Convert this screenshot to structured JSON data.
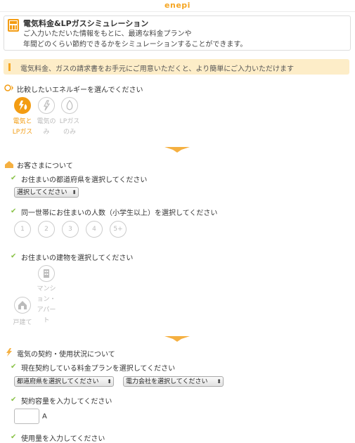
{
  "logo": "enepi",
  "intro": {
    "title": "電気料金&LPガスシミュレーション",
    "line1": "ご入力いただいた情報をもとに、最適な料金プランや",
    "line2": "年間どのくらい節約できるかをシミュレーションすることができます。"
  },
  "notice": "電気料金、ガスの請求書をお手元にご用意いただくと、より簡単にご入力いただけます",
  "energy": {
    "title": "比較したいエネルギーを選んでください",
    "options": [
      {
        "line1": "電気と",
        "line2": "LPガス"
      },
      {
        "line1": "電気の",
        "line2": "み"
      },
      {
        "line1": "LPガス",
        "line2": "のみ"
      }
    ]
  },
  "customer": {
    "title": "お客さまについて",
    "q_pref": "お住まいの都道府県を選択してください",
    "pref_select": "選択してください",
    "q_people": "同一世帯にお住まいの人数（小学生以上）を選択してください",
    "people": [
      "1",
      "2",
      "3",
      "4",
      "5+"
    ],
    "q_building": "お住まいの建物を選択してください",
    "house_label": "戸建て",
    "mansion_label": [
      "マンシ",
      "ョン・",
      "アパー",
      "ト"
    ]
  },
  "electric": {
    "title": "電気の契約・使用状況について",
    "q_plan": "現在契約している料金プランを選択してください",
    "pref_select": "都道府県を選択してください",
    "company_select": "電力会社を選択してください",
    "q_capacity": "契約容量を入力してください",
    "capacity_unit": "A",
    "q_usage": "使用量を入力してください"
  }
}
